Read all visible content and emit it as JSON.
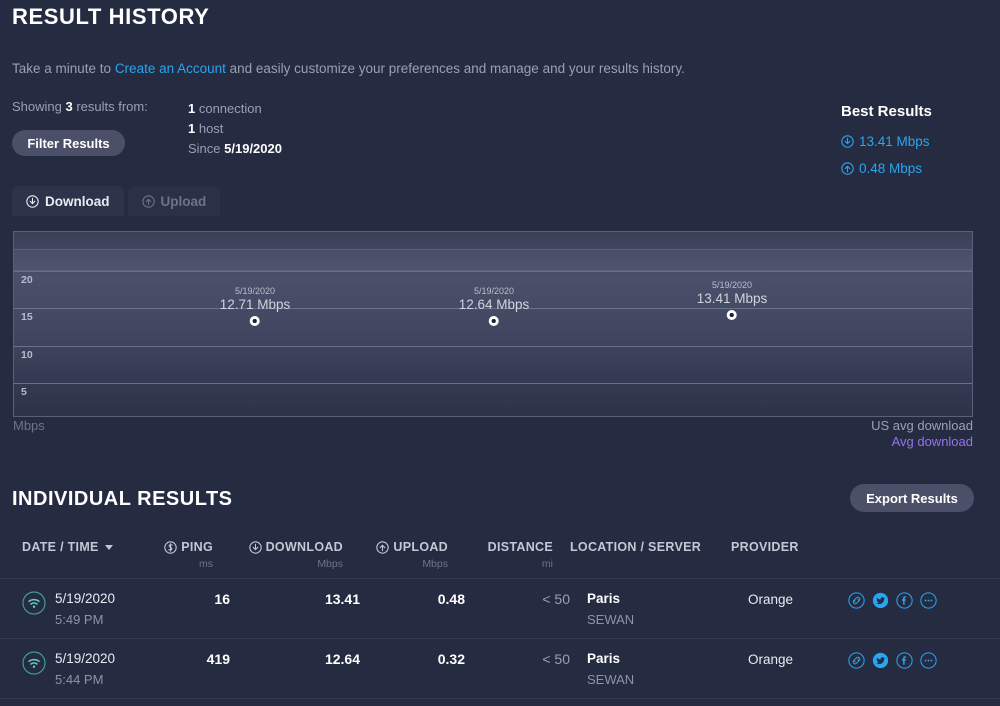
{
  "page": {
    "title": "RESULT HISTORY",
    "intro_before": "Take a minute to ",
    "intro_link": "Create an Account",
    "intro_after": " and easily customize your preferences and manage and your results history."
  },
  "summary": {
    "showing_prefix": "Showing ",
    "count": "3",
    "showing_suffix": " results from:",
    "connections": "1",
    "connections_label": " connection",
    "hosts": "1",
    "hosts_label": " host",
    "since_label": "Since ",
    "since_date": "5/19/2020",
    "filter_button": "Filter Results"
  },
  "best_results": {
    "heading": "Best Results",
    "download": "13.41 Mbps",
    "upload": "0.48 Mbps",
    "download_icon": "download-circle-icon",
    "upload_icon": "upload-circle-icon",
    "accent": "#2aa5f0"
  },
  "tabs": [
    {
      "label": "Download",
      "icon": "download-circle-icon",
      "active": true
    },
    {
      "label": "Upload",
      "icon": "upload-circle-icon",
      "active": false
    }
  ],
  "chart_data": {
    "type": "scatter",
    "title": "",
    "xlabel": "",
    "ylabel": "Mbps",
    "ylim": [
      0,
      23
    ],
    "yticks": [
      20,
      15,
      10,
      5
    ],
    "grid": true,
    "x": [
      "5/19/2020",
      "5/19/2020",
      "5/19/2020"
    ],
    "values": [
      12.71,
      12.64,
      13.41
    ],
    "point_labels": [
      "12.71 Mbps",
      "12.64 Mbps",
      "13.41 Mbps"
    ],
    "point_dates": [
      "5/19/2020",
      "5/19/2020",
      "5/19/2020"
    ],
    "legend_position": "bottom-right",
    "legend": [
      {
        "name": "US avg download",
        "color": "#9aa0b4"
      },
      {
        "name": "Avg download",
        "color": "#9b6ff0"
      }
    ],
    "unit_label": "Mbps"
  },
  "results_section": {
    "heading": "INDIVIDUAL RESULTS",
    "export_button": "Export Results"
  },
  "table": {
    "columns": [
      {
        "label": "DATE / TIME",
        "sub": "",
        "icon": "sort-desc-caret"
      },
      {
        "label": "PING",
        "sub": "ms",
        "icon": "ping-circle-icon"
      },
      {
        "label": "DOWNLOAD",
        "sub": "Mbps",
        "icon": "download-circle-icon"
      },
      {
        "label": "UPLOAD",
        "sub": "Mbps",
        "icon": "upload-circle-icon"
      },
      {
        "label": "DISTANCE",
        "sub": "mi",
        "icon": ""
      },
      {
        "label": "LOCATION / SERVER",
        "sub": "",
        "icon": ""
      },
      {
        "label": "PROVIDER",
        "sub": "",
        "icon": ""
      }
    ],
    "rows": [
      {
        "connection_icon": "wifi-icon",
        "date": "5/19/2020",
        "time": "5:49 PM",
        "ping": "16",
        "download": "13.41",
        "upload": "0.48",
        "distance": "< 50",
        "location": "Paris",
        "server": "SEWAN",
        "provider": "Orange",
        "actions": [
          "link-icon",
          "twitter-icon",
          "facebook-icon",
          "more-icon"
        ]
      },
      {
        "connection_icon": "wifi-icon",
        "date": "5/19/2020",
        "time": "5:44 PM",
        "ping": "419",
        "download": "12.64",
        "upload": "0.32",
        "distance": "< 50",
        "location": "Paris",
        "server": "SEWAN",
        "provider": "Orange",
        "actions": [
          "link-icon",
          "twitter-icon",
          "facebook-icon",
          "more-icon"
        ]
      }
    ]
  }
}
